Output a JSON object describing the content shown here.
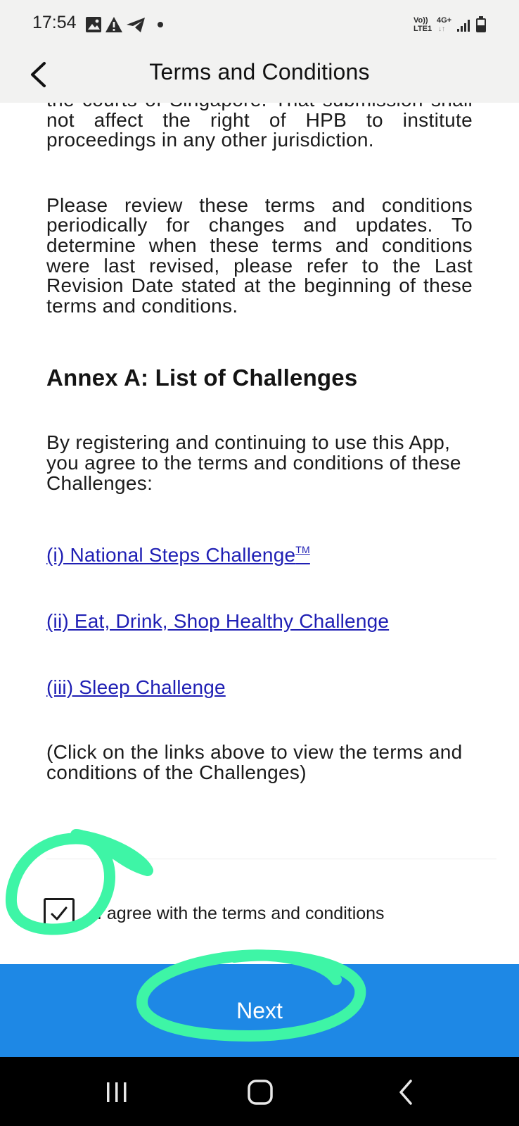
{
  "status_bar": {
    "time": "17:54",
    "left_icons": [
      "gallery-icon",
      "warning-icon",
      "telegram-icon",
      "dot-icon"
    ],
    "right_icons": [
      "volte-lte-icon",
      "4g-plus-icon",
      "signal-icon",
      "battery-icon"
    ],
    "volte_label": "Vo)) LTE1",
    "network_label": "4G+"
  },
  "header": {
    "title": "Terms and Conditions"
  },
  "content": {
    "paragraph_1": "the courts of Singapore. That submission shall not affect the right of HPB to institute proceedings in any other jurisdiction.",
    "paragraph_2": "Please review these terms and conditions periodically for changes and updates. To determine when these terms and conditions were last revised, please refer to the Last Revision Date stated at the beginning of these terms and conditions.",
    "annex_heading": "Annex A: List of Challenges",
    "paragraph_3": "By registering and continuing to use this App, you agree to the terms and conditions of these Challenges:",
    "links": [
      {
        "label": "(i) National Steps Challenge",
        "suffix": "TM"
      },
      {
        "label": "(ii) Eat, Drink, Shop Healthy Challenge"
      },
      {
        "label": "(iii) Sleep Challenge"
      }
    ],
    "paragraph_4": "(Click on the links above to view the terms and conditions of the Challenges)"
  },
  "agreement": {
    "checked": true,
    "label": "I agree with the terms and conditions"
  },
  "next_button": {
    "label": "Next",
    "color": "#1e88e5"
  },
  "nav_bar": {
    "buttons": [
      "recent-apps-icon",
      "home-icon",
      "back-icon"
    ]
  },
  "colors": {
    "header_bg": "#f2f2f1",
    "link": "#1f1fb4",
    "annotation": "#3ef5a6"
  }
}
